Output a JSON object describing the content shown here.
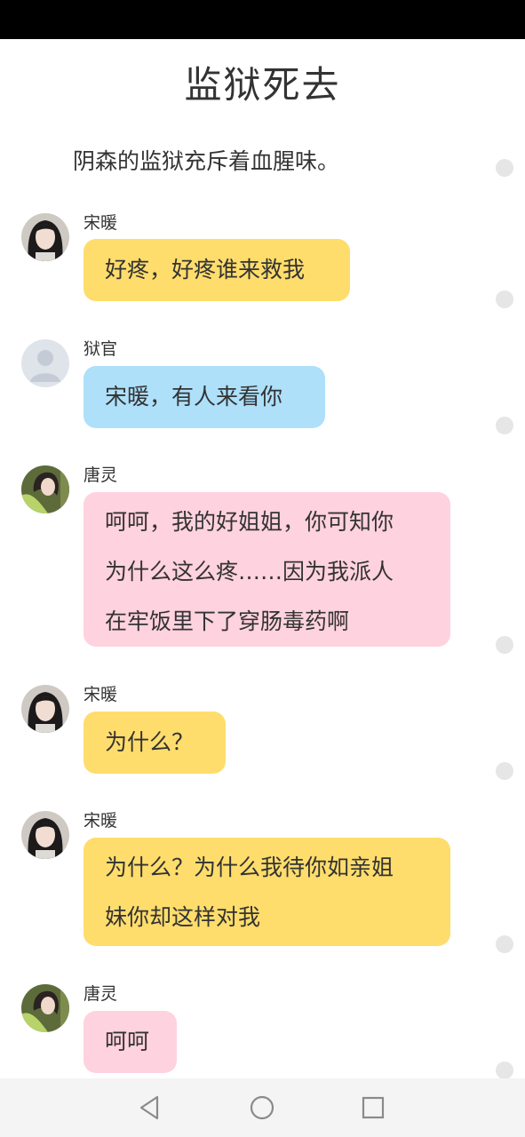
{
  "title": "监狱死去",
  "narration": "阴森的监狱充斥着血腥味。",
  "messages": [
    {
      "speaker": "宋暖",
      "avatar": "girl-dark-hair-avatar",
      "color": "#fedd6c",
      "lines": [
        "好疼，好疼谁来救我"
      ]
    },
    {
      "speaker": "狱官",
      "avatar": "default-user-avatar",
      "color": "#aee0fa",
      "lines": [
        "宋暖，有人来看你"
      ]
    },
    {
      "speaker": "唐灵",
      "avatar": "girl-green-shirt-avatar",
      "color": "#ffd2df",
      "lines": [
        "呵呵，我的好姐姐，你可知你",
        "为什么这么疼……因为我派人",
        "在牢饭里下了穿肠毒药啊"
      ]
    },
    {
      "speaker": "宋暖",
      "avatar": "girl-dark-hair-avatar",
      "color": "#fedd6c",
      "lines": [
        "为什么？"
      ]
    },
    {
      "speaker": "宋暖",
      "avatar": "girl-dark-hair-avatar",
      "color": "#fedd6c",
      "lines": [
        "为什么？为什么我待你如亲姐",
        "妹你却这样对我"
      ]
    },
    {
      "speaker": "唐灵",
      "avatar": "girl-green-shirt-avatar",
      "color": "#ffd2df",
      "lines": [
        "呵呵"
      ]
    }
  ],
  "nav": {
    "back": "back-triangle-icon",
    "home": "home-circle-icon",
    "recents": "recents-square-icon"
  }
}
